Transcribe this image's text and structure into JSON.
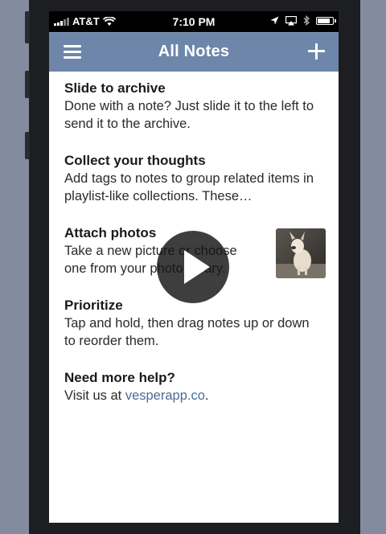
{
  "status_bar": {
    "carrier": "AT&T",
    "time": "7:10 PM",
    "icons": [
      "signal-icon",
      "wifi-icon",
      "location-icon",
      "airplay-icon",
      "bluetooth-icon",
      "battery-icon"
    ]
  },
  "nav": {
    "title": "All Notes",
    "left_icon": "menu-icon",
    "right_icon": "plus-icon"
  },
  "notes": [
    {
      "title": "Slide to archive",
      "body": "Done with a note? Just slide it to the left to send it to the archive."
    },
    {
      "title": "Collect your thoughts",
      "body": "Add tags to notes to group related items in playlist-like collections. These…"
    },
    {
      "title": "Attach photos",
      "body": "Take a new picture or choose one from your photo library.",
      "has_thumbnail": true
    },
    {
      "title": "Prioritize",
      "body": "Tap and hold, then drag notes up or down to reorder them."
    },
    {
      "title": "Need more help?",
      "body_prefix": "Visit us at ",
      "link": "vesperapp.co",
      "body_suffix": "."
    }
  ],
  "overlay": {
    "icon": "play-icon"
  },
  "colors": {
    "nav_bar": "#6d86aa",
    "link": "#4b6b9b",
    "background": "#838c9e"
  }
}
